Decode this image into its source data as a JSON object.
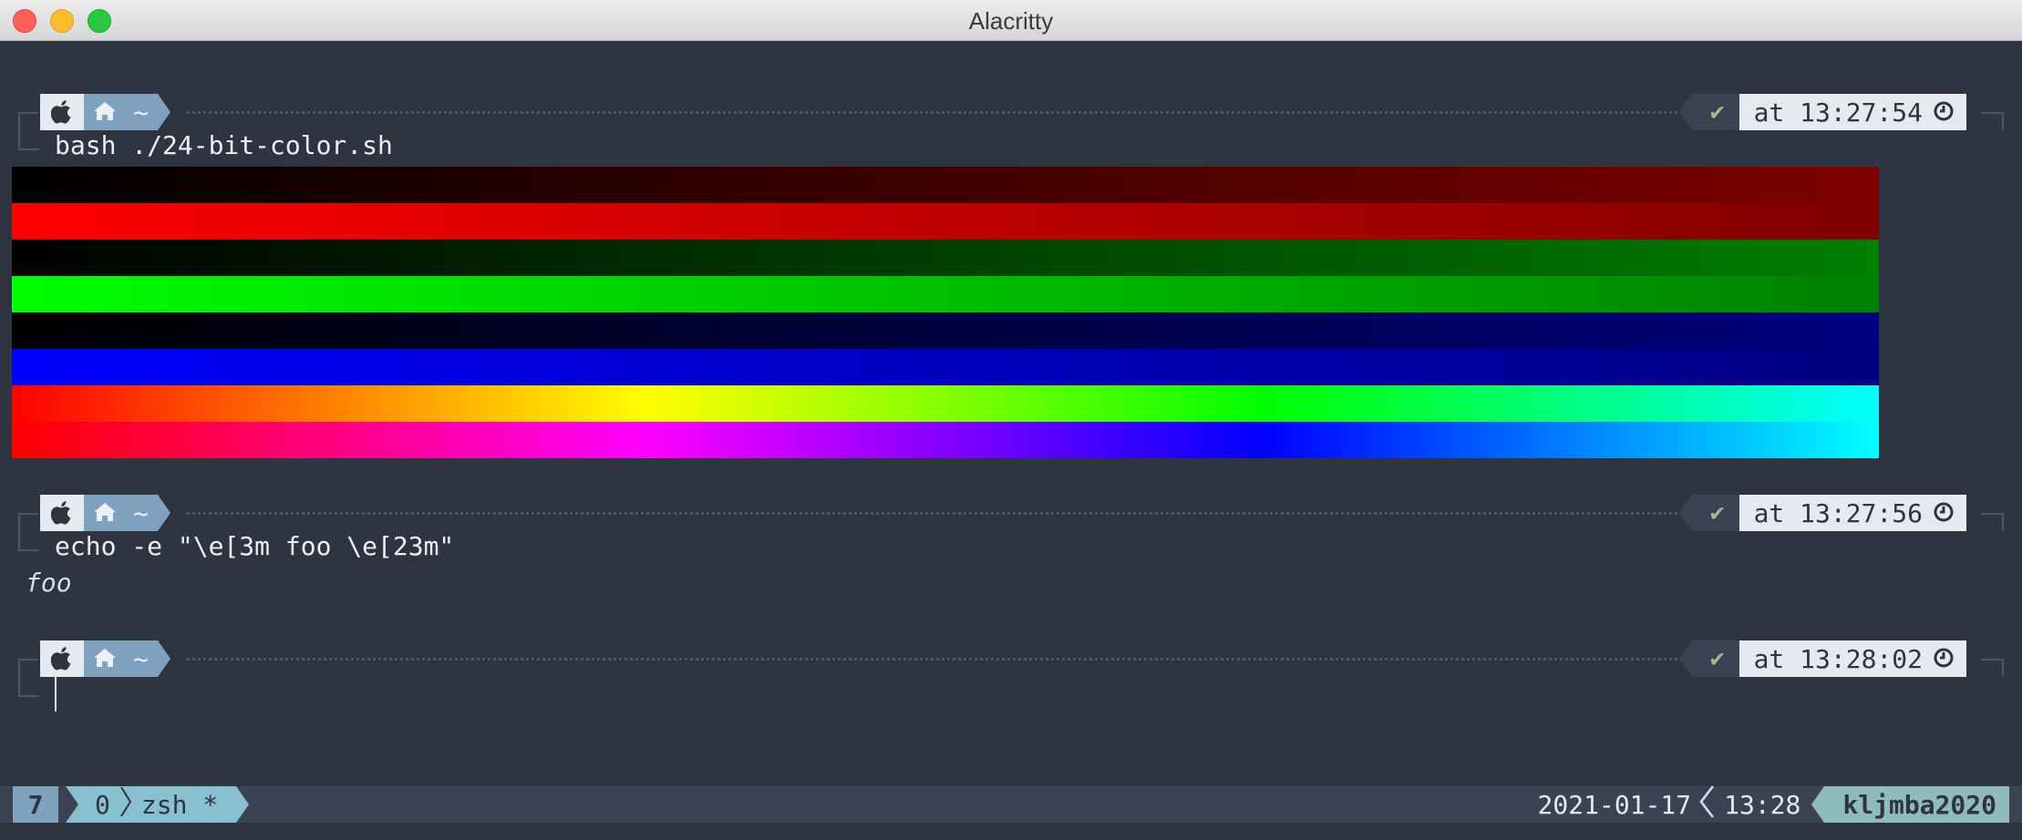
{
  "window": {
    "title": "Alacritty"
  },
  "prompts": [
    {
      "dir": "~",
      "status": "✔",
      "time": "at 13:27:54",
      "command": "bash ./24-bit-color.sh"
    },
    {
      "dir": "~",
      "status": "✔",
      "time": "at 13:27:56",
      "command": "echo -e \"\\e[3m foo \\e[23m\"",
      "output": "foo"
    },
    {
      "dir": "~",
      "status": "✔",
      "time": "at 13:28:02",
      "command": ""
    }
  ],
  "color_bars": [
    {
      "name": "red-dark",
      "from": "#000000",
      "to": "#7f0000"
    },
    {
      "name": "red-bright",
      "from": "#ff0000",
      "to": "#800000"
    },
    {
      "name": "green-dark",
      "from": "#000000",
      "to": "#007f00"
    },
    {
      "name": "green-bright",
      "from": "#00ff00",
      "to": "#008000"
    },
    {
      "name": "blue-dark",
      "from": "#000000",
      "to": "#00007f"
    },
    {
      "name": "blue-bright",
      "from": "#0000ff",
      "to": "#000080"
    },
    {
      "name": "rainbow-1",
      "stops": [
        "#ff0000",
        "#ffff00",
        "#00ff00",
        "#00ffff"
      ]
    },
    {
      "name": "rainbow-2",
      "stops": [
        "#ff0000",
        "#ff00ff",
        "#0000ff",
        "#00ffff"
      ]
    }
  ],
  "icons": {
    "apple": "apple-icon",
    "home": "home-icon",
    "clock": "clock-icon",
    "check": "check-icon"
  },
  "statusline": {
    "window_index": "7",
    "tab_index": "0",
    "tab_name": "zsh *",
    "date": "2021-01-17",
    "time": "13:28",
    "host": "kljmba2020"
  },
  "colors": {
    "background": "#2e3440",
    "accent": "#81a1c1",
    "host_bg": "#8fbcbb",
    "success": "#a3be8c"
  }
}
